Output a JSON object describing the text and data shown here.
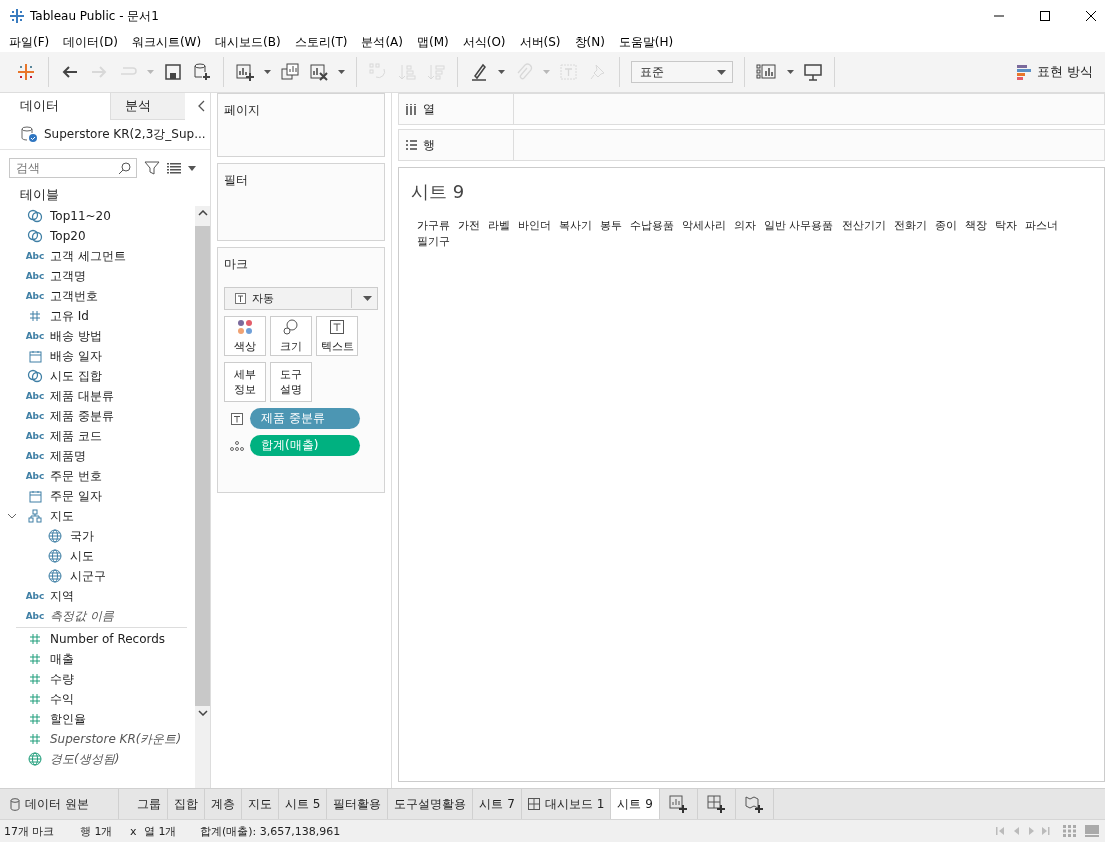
{
  "window": {
    "title": "Tableau Public - 문서1"
  },
  "menu": [
    "파일(F)",
    "데이터(D)",
    "워크시트(W)",
    "대시보드(B)",
    "스토리(T)",
    "분석(A)",
    "맵(M)",
    "서식(O)",
    "서버(S)",
    "창(N)",
    "도움말(H)"
  ],
  "toolbar": {
    "groups": [
      [
        {
          "kind": "logo",
          "disabled": false
        }
      ],
      [
        {
          "kind": "back",
          "disabled": false
        },
        {
          "kind": "forward",
          "disabled": true
        },
        {
          "kind": "redo",
          "disabled": true,
          "dropdown": true
        },
        {
          "kind": "save",
          "disabled": false
        },
        {
          "kind": "new-source",
          "disabled": false
        }
      ],
      [
        {
          "kind": "new-sheet",
          "disabled": false,
          "dropdown": true
        },
        {
          "kind": "duplicate",
          "disabled": false
        },
        {
          "kind": "clear",
          "disabled": false,
          "dropdown": true
        }
      ],
      [
        {
          "kind": "swap",
          "disabled": true
        },
        {
          "kind": "sort-asc",
          "disabled": true
        },
        {
          "kind": "sort-desc",
          "disabled": true
        }
      ],
      [
        {
          "kind": "highlight",
          "disabled": false,
          "dropdown": true
        },
        {
          "kind": "clip",
          "disabled": true,
          "dropdown": true
        },
        {
          "kind": "label",
          "disabled": true
        },
        {
          "kind": "pin",
          "disabled": true
        }
      ]
    ],
    "fit": "표준",
    "show_me": "표현 방식"
  },
  "data_pane": {
    "tabs": [
      {
        "label": "데이터",
        "selected": true
      },
      {
        "label": "분석",
        "selected": false
      }
    ],
    "source": "Superstore KR(2,3강_Sup...",
    "search": {
      "placeholder": "검색"
    },
    "heading": "테이블",
    "fields": [
      {
        "kind": "set",
        "name": "Top11~20"
      },
      {
        "kind": "set",
        "name": "Top20"
      },
      {
        "kind": "text",
        "type_label": "Abc",
        "name": "고객 세그먼트"
      },
      {
        "kind": "text",
        "type_label": "Abc",
        "name": "고객명"
      },
      {
        "kind": "text",
        "type_label": "Abc",
        "name": "고객번호"
      },
      {
        "kind": "number-dim",
        "name": "고유 Id"
      },
      {
        "kind": "text",
        "type_label": "Abc",
        "name": "배송 방법"
      },
      {
        "kind": "date",
        "name": "배송 일자"
      },
      {
        "kind": "set",
        "name": "시도 집합"
      },
      {
        "kind": "text",
        "type_label": "Abc",
        "name": "제품 대분류"
      },
      {
        "kind": "text",
        "type_label": "Abc",
        "name": "제품 중분류"
      },
      {
        "kind": "text",
        "type_label": "Abc",
        "name": "제품 코드"
      },
      {
        "kind": "text",
        "type_label": "Abc",
        "name": "제품명"
      },
      {
        "kind": "text",
        "type_label": "Abc",
        "name": "주문 번호"
      },
      {
        "kind": "date",
        "name": "주문 일자"
      },
      {
        "kind": "hierarchy",
        "name": "지도",
        "expanded": true,
        "children": [
          {
            "kind": "geo",
            "name": "국가"
          },
          {
            "kind": "geo",
            "name": "시도"
          },
          {
            "kind": "geo",
            "name": "시군구"
          }
        ]
      },
      {
        "kind": "text",
        "type_label": "Abc",
        "name": "지역"
      },
      {
        "kind": "text",
        "type_label": "Abc",
        "name": "측정값 이름",
        "italic": true
      },
      {
        "kind": "divider"
      },
      {
        "kind": "measure",
        "name": "Number of Records"
      },
      {
        "kind": "measure",
        "name": "매출"
      },
      {
        "kind": "measure",
        "name": "수량"
      },
      {
        "kind": "measure",
        "name": "수익"
      },
      {
        "kind": "measure",
        "name": "할인율"
      },
      {
        "kind": "measure",
        "name": "Superstore KR(카운트)",
        "italic": true
      },
      {
        "kind": "geo-measure",
        "name": "경도(생성됨)",
        "italic": true
      }
    ]
  },
  "cards": {
    "pages": "페이지",
    "filters": "필터",
    "marks": {
      "title": "마크",
      "type": "자동",
      "buttons": [
        {
          "kind": "color",
          "label": "색상"
        },
        {
          "kind": "size",
          "label": "크기"
        },
        {
          "kind": "text",
          "label": "텍스트"
        },
        {
          "kind": "detail",
          "label": "세부\n정보"
        },
        {
          "kind": "tooltip",
          "label": "도구\n설명"
        }
      ],
      "pills": [
        {
          "kind": "text",
          "label": "제품 중분류",
          "color": "#4c96b3"
        },
        {
          "kind": "detail",
          "label": "합계(매출)",
          "color": "#00b180"
        }
      ]
    }
  },
  "shelves": [
    {
      "kind": "columns",
      "label": "열"
    },
    {
      "kind": "rows",
      "label": "행"
    }
  ],
  "view": {
    "title": "시트 9",
    "items": [
      "가구류",
      "가전",
      "라벨",
      "바인더",
      "복사기",
      "봉투",
      "수납용품",
      "악세사리",
      "의자",
      "일반 사무용품",
      "전산기기",
      "전화기",
      "종이",
      "책장",
      "탁자",
      "파스너",
      "필기구"
    ]
  },
  "sheet_tabs": [
    {
      "kind": "source",
      "label": "데이터 원본",
      "selected": false
    },
    {
      "kind": "sheet",
      "label": "그룹",
      "selected": false
    },
    {
      "kind": "sheet",
      "label": "집합",
      "selected": false
    },
    {
      "kind": "sheet",
      "label": "계층",
      "selected": false
    },
    {
      "kind": "sheet",
      "label": "지도",
      "selected": false
    },
    {
      "kind": "sheet",
      "label": "시트 5",
      "selected": false
    },
    {
      "kind": "sheet",
      "label": "필터활용",
      "selected": false
    },
    {
      "kind": "sheet",
      "label": "도구설명활용",
      "selected": false
    },
    {
      "kind": "sheet",
      "label": "시트 7",
      "selected": false
    },
    {
      "kind": "dashboard",
      "label": "대시보드 1",
      "selected": false
    },
    {
      "kind": "sheet",
      "label": "시트 9",
      "selected": true
    }
  ],
  "status_bar": {
    "marks": "17개 마크",
    "rows": "행 1개",
    "times": "x",
    "cols": "열 1개",
    "sum": "합계(매출): 3,657,138,961"
  }
}
